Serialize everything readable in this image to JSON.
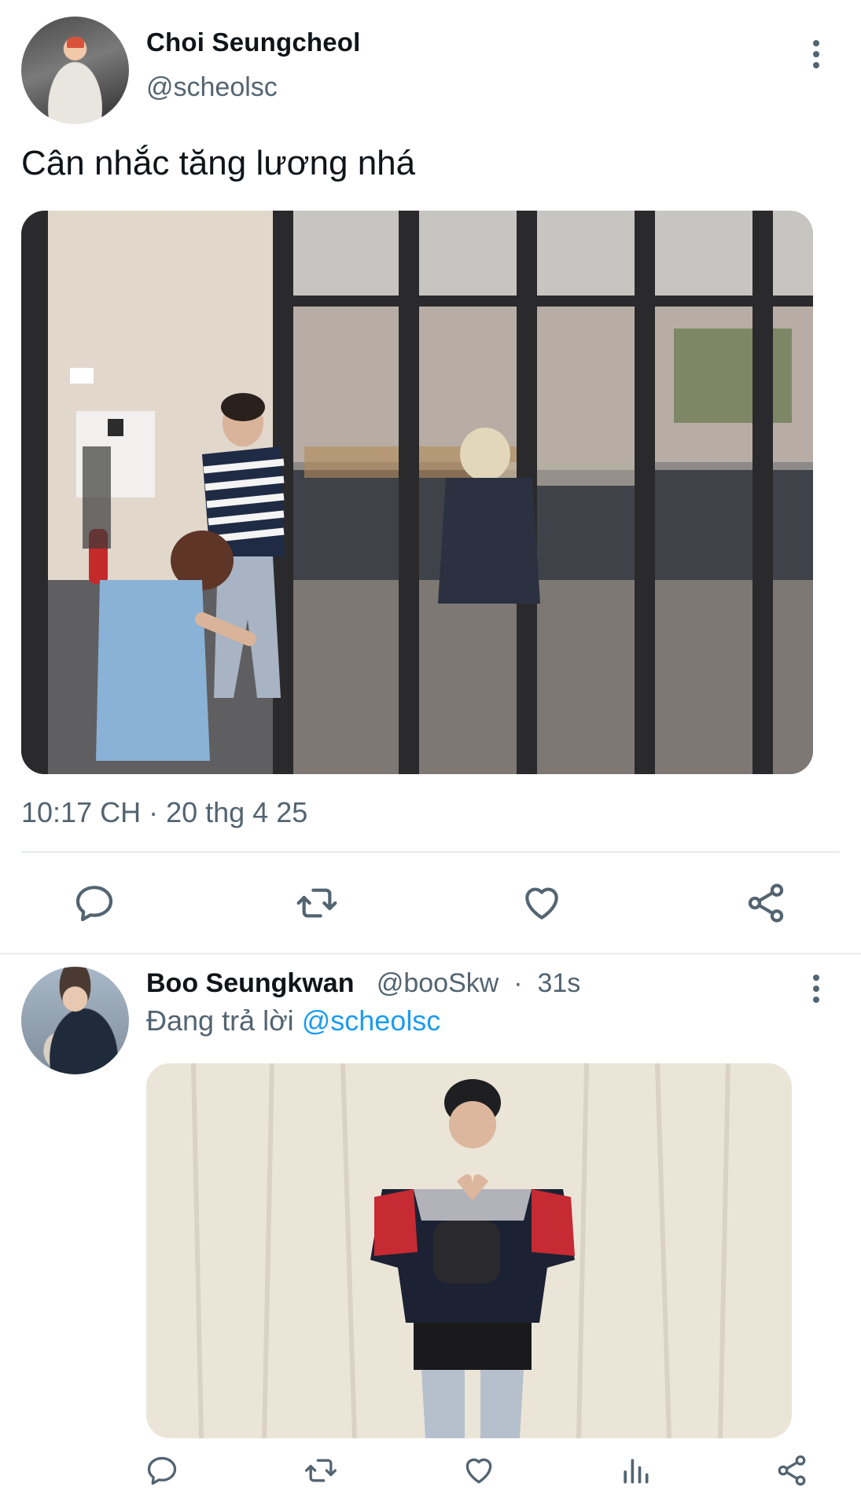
{
  "main_tweet": {
    "author_name": "Choi Seungcheol",
    "author_handle": "@scheolsc",
    "text": "Cân nhắc tăng lương nhá",
    "timestamp": "10:17 CH · 20 thg 4 25",
    "avatar_icon": "user-avatar",
    "media_icon": "tweet-photo",
    "actions": [
      "reply-icon",
      "retweet-icon",
      "like-icon",
      "share-icon"
    ]
  },
  "reply_tweet": {
    "author_name": "Boo Seungkwan",
    "author_handle": "@booSkw",
    "time": "31s",
    "replying_prefix": "Đang trả lời",
    "replying_to": "@scheolsc",
    "avatar_icon": "user-avatar",
    "media_icon": "tweet-photo",
    "actions": [
      "reply-icon",
      "retweet-icon",
      "like-icon",
      "analytics-icon",
      "share-icon"
    ]
  },
  "colors": {
    "text_primary": "#0f1419",
    "text_secondary": "#536471",
    "link": "#1d9bf0",
    "divider": "#e6e9ec"
  }
}
